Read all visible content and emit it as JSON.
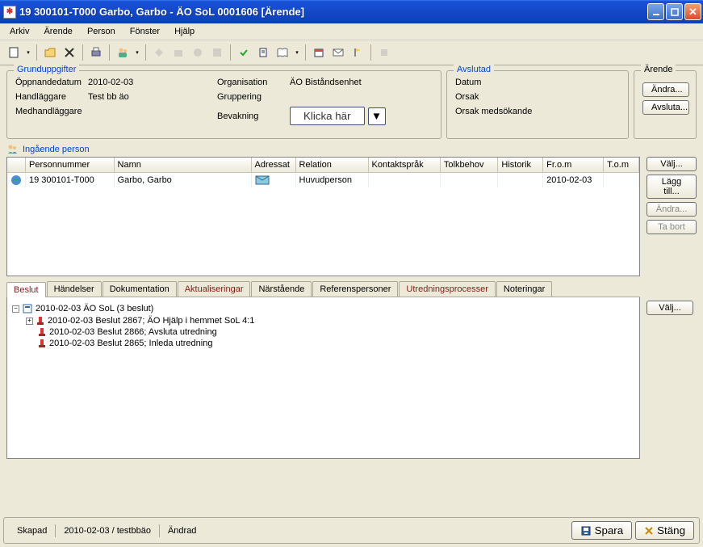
{
  "title": "19 300101-T000   Garbo, Garbo   -   ÄO SoL   0001606   [Ärende]",
  "menu": [
    "Arkiv",
    "Ärende",
    "Person",
    "Fönster",
    "Hjälp"
  ],
  "fieldsets": {
    "grund_title": "Grunduppgifter",
    "avslut_title": "Avslutad",
    "arende_title": "Ärende"
  },
  "grund": {
    "oppnande_label": "Öppnandedatum",
    "oppnande_val": "2010-02-03",
    "handlaggare_label": "Handläggare",
    "handlaggare_val": "Test bb äo",
    "medhand_label": "Medhandläggare",
    "medhand_val": "",
    "org_label": "Organisation",
    "org_val": "ÄO Biståndsenhet",
    "grupp_label": "Gruppering",
    "grupp_val": "",
    "bevak_label": "Bevakning",
    "klicka_label": "Klicka här"
  },
  "avslut": {
    "datum_label": "Datum",
    "orsak_label": "Orsak",
    "orsak_med_label": "Orsak medsökande"
  },
  "arende": {
    "andra_label": "Ändra...",
    "avsluta_label": "Avsluta..."
  },
  "person": {
    "header": "Ingående person",
    "cols": [
      "",
      "Personnummer",
      "Namn",
      "Adressat",
      "Relation",
      "Kontaktspråk",
      "Tolkbehov",
      "Historik",
      "Fr.o.m",
      "T.o.m"
    ],
    "rows": [
      {
        "pnr": "19 300101-T000",
        "namn": "Garbo, Garbo",
        "adressat_icon": true,
        "relation": "Huvudperson",
        "kontakt": "",
        "tolk": "",
        "hist": "",
        "from": "2010-02-03",
        "tom": ""
      }
    ],
    "btns": {
      "valj": "Välj...",
      "lagg": "Lägg till...",
      "andra": "Ändra...",
      "tabort": "Ta bort"
    }
  },
  "tabs": [
    "Beslut",
    "Händelser",
    "Dokumentation",
    "Aktualiseringar",
    "Närstående",
    "Referenspersoner",
    "Utredningsprocesser",
    "Noteringar"
  ],
  "tabs_red": [
    3,
    6
  ],
  "active_tab": 0,
  "tree": {
    "root": "2010-02-03  ÄO SoL  (3 beslut)",
    "children": [
      "2010-02-03  Beslut 2867; ÄO Hjälp i hemmet SoL 4:1",
      "2010-02-03  Beslut 2866; Avsluta utredning",
      "2010-02-03  Beslut 2865; Inleda utredning"
    ]
  },
  "tabs_btn_valj": "Välj...",
  "status": {
    "skapad_label": "Skapad",
    "skapad_val": "2010-02-03 / testbbäo",
    "andrad_label": "Ändrad",
    "spara": "Spara",
    "stang": "Stäng"
  }
}
